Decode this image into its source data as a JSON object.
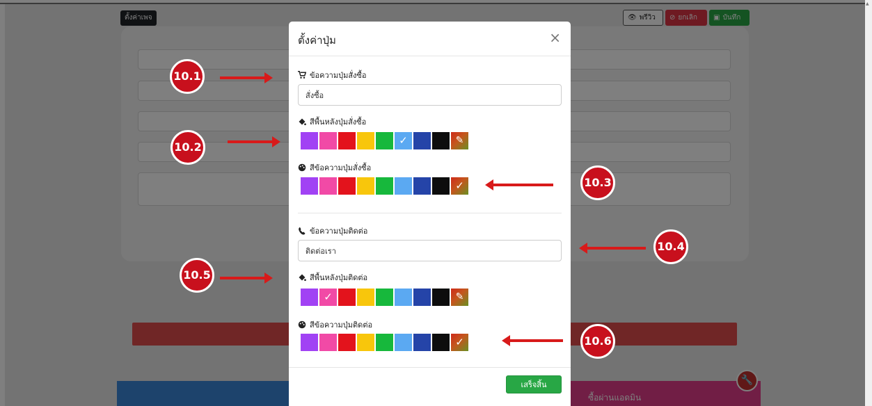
{
  "background": {
    "page_settings_label": "ตั้งค่าเพจ",
    "preview_label": "พรีวิว",
    "cancel_label": "ยกเลิก",
    "save_label": "บันทึก",
    "admin_text": "ซื้อผ่านแอดมิน"
  },
  "modal": {
    "title": "ตั้งค่าปุ่ม",
    "close": "×",
    "buy_section": {
      "text_label": "ข้อความปุ่มสั่งซื้อ",
      "text_value": "สั่งซื้อ",
      "bg_label": "สีพื้นหลังปุ่มสั่งซื้อ",
      "text_color_label": "สีข้อความปุ่มสั่งซื้อ"
    },
    "contact_section": {
      "text_label": "ข้อความปุ่มติดต่อ",
      "text_value": "ติดต่อเรา",
      "bg_label": "สีพื้นหลังปุ่มติดต่อ",
      "text_color_label": "สีข้อความปุ่มติดต่อ"
    },
    "done_label": "เสร็จสิ้น"
  },
  "colors": {
    "palette": [
      "#a142f4",
      "#f14aa6",
      "#e3131c",
      "#f8c60c",
      "#17b83c",
      "#5ba9f2",
      "#2544a8",
      "#0d0d0d"
    ],
    "buy_bg_selected": 5,
    "buy_text_selected": 8,
    "contact_bg_selected": 1,
    "contact_text_selected": 8
  },
  "annotations": [
    "10.1",
    "10.2",
    "10.3",
    "10.4",
    "10.5",
    "10.6"
  ]
}
